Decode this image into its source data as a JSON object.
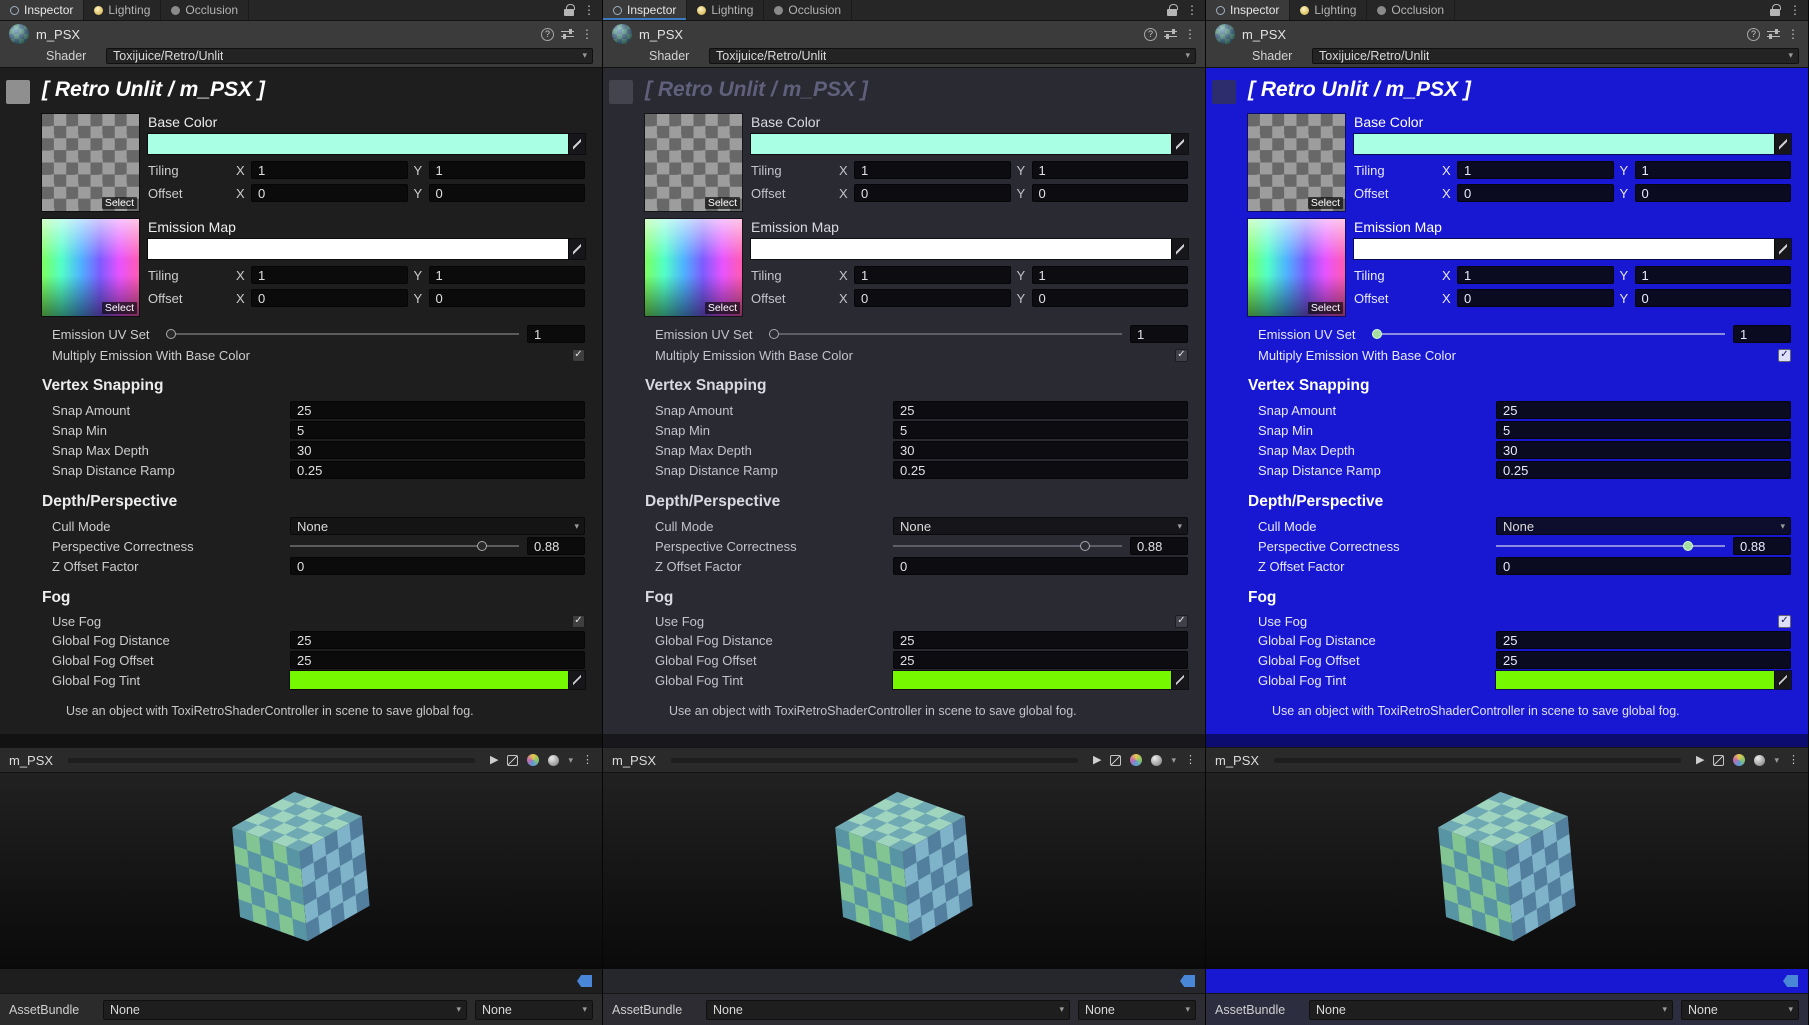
{
  "inspector": {
    "tabs": [
      {
        "label": "Inspector"
      },
      {
        "label": "Lighting"
      },
      {
        "label": "Occlusion"
      }
    ],
    "material": {
      "name": "m_PSX"
    },
    "shader": {
      "label": "Shader",
      "value": "Toxijuice/Retro/Unlit"
    },
    "title": "[ Retro Unlit / m_PSX ]",
    "axis": {
      "x": "X",
      "y": "Y"
    },
    "maps": [
      {
        "label": "Base Color",
        "select_label": "Select",
        "color": "#a9ffe4",
        "tiling_label": "Tiling",
        "offset_label": "Offset",
        "tiling_x": "1",
        "tiling_y": "1",
        "offset_x": "0",
        "offset_y": "0"
      },
      {
        "label": "Emission Map",
        "select_label": "Select",
        "color": "#ffffff",
        "tiling_label": "Tiling",
        "offset_label": "Offset",
        "tiling_x": "1",
        "tiling_y": "1",
        "offset_x": "0",
        "offset_y": "0"
      }
    ],
    "emission_uv": {
      "label": "Emission UV Set",
      "value": "1"
    },
    "multiply_emission": {
      "label": "Multiply Emission With Base Color",
      "checked": true
    },
    "sections": [
      {
        "title": "Vertex Snapping",
        "rows": [
          {
            "label": "Snap Amount",
            "value": "25"
          },
          {
            "label": "Snap Min",
            "value": "5"
          },
          {
            "label": "Snap Max Depth",
            "value": "30"
          },
          {
            "label": "Snap Distance Ramp",
            "value": "0.25"
          }
        ]
      },
      {
        "title": "Depth/Perspective",
        "cull_mode": {
          "label": "Cull Mode",
          "value": "None"
        },
        "perspective": {
          "label": "Perspective Correctness",
          "value": "0.88"
        },
        "z_offset": {
          "label": "Z Offset Factor",
          "value": "0"
        }
      },
      {
        "title": "Fog",
        "use_fog": {
          "label": "Use Fog",
          "checked": true
        },
        "distance": {
          "label": "Global Fog Distance",
          "value": "25"
        },
        "offset": {
          "label": "Global Fog Offset",
          "value": "25"
        },
        "tint": {
          "label": "Global Fog Tint",
          "color": "#76f800"
        }
      }
    ],
    "note": "Use an object with ToxiRetroShaderController in scene to save global fog."
  },
  "preview": {
    "name": "m_PSX",
    "cube_colors": {
      "top_a": "#9fd4bf",
      "top_b": "#6fa9b4",
      "left_a": "#83c493",
      "left_b": "#5795a4",
      "right_a": "#7fb3c9",
      "right_b": "#537f9f"
    }
  },
  "footer": {
    "label": "AssetBundle",
    "bundle_value": "None",
    "variant_value": "None"
  },
  "icons": {
    "help": "?",
    "kebab": "⋮",
    "caret": "▾",
    "check": "✓",
    "play": "▶"
  },
  "panels": [
    {
      "name": "inspector-panel-gray",
      "focused_tab": false,
      "theme": {
        "tab-bg": "#262626",
        "tab-active-bg": "#3a3a3a",
        "header-bg": "#3b3b3b",
        "content-bg": "#1e1e1e",
        "band-bg": "#121212",
        "title-color": "#ffffff",
        "heading-color": "#ececec",
        "label-color": "#cdcdcd",
        "note-color": "#c8c8c8",
        "field-bg": "#0b0b0b",
        "field-text": "#e0e0e0",
        "dd-bg": "#141414",
        "chip-bg": "#8f8f8f",
        "check-bg": "#3f3f3f",
        "check-mark": "#e0e0e0",
        "knob-bg": "#2a2a2a",
        "knob-border": "#aaaaaa",
        "track-color": "#5c5c5c",
        "tagstrip-bg": "#1e1e1e",
        "footer-bg": "#2b2b2b"
      }
    },
    {
      "name": "inspector-panel-dark",
      "focused_tab": true,
      "theme": {
        "tab-bg": "#262626",
        "tab-active-bg": "#3a3a3a",
        "header-bg": "#3b3b3b",
        "content-bg": "#2a2a32",
        "band-bg": "#17171c",
        "title-color": "#60607c",
        "heading-color": "#d9d9e0",
        "label-color": "#c3c3cd",
        "note-color": "#c3c3cb",
        "field-bg": "#0c0c11",
        "field-text": "#e0e0e6",
        "dd-bg": "#15151a",
        "chip-bg": "#44444e",
        "check-bg": "#40404a",
        "check-mark": "#e0e0e6",
        "knob-bg": "#2c2c34",
        "knob-border": "#a8a8b4",
        "track-color": "#5e5e6a",
        "tagstrip-bg": "#26262d",
        "footer-bg": "#2c2c32"
      }
    },
    {
      "name": "inspector-panel-blue",
      "focused_tab": false,
      "theme": {
        "tab-bg": "#262626",
        "tab-active-bg": "#3a3a3a",
        "header-bg": "#3b3b3b",
        "content-bg": "#1818d2",
        "band-bg": "#0c0c70",
        "title-color": "#ffffff",
        "heading-color": "#ffffff",
        "label-color": "#e9e9ff",
        "note-color": "#e2e2ff",
        "field-bg": "#0a0a20",
        "field-text": "#eaeaff",
        "dd-bg": "#0d0d2e",
        "chip-bg": "#2d2d6e",
        "check-bg": "#dde0f8",
        "check-mark": "#14145a",
        "knob-bg": "#a5dca0",
        "knob-border": "#d8ffd0",
        "track-color": "#8d8de0",
        "tagstrip-bg": "#1818d2",
        "footer-bg": "#2d2d40"
      }
    }
  ]
}
